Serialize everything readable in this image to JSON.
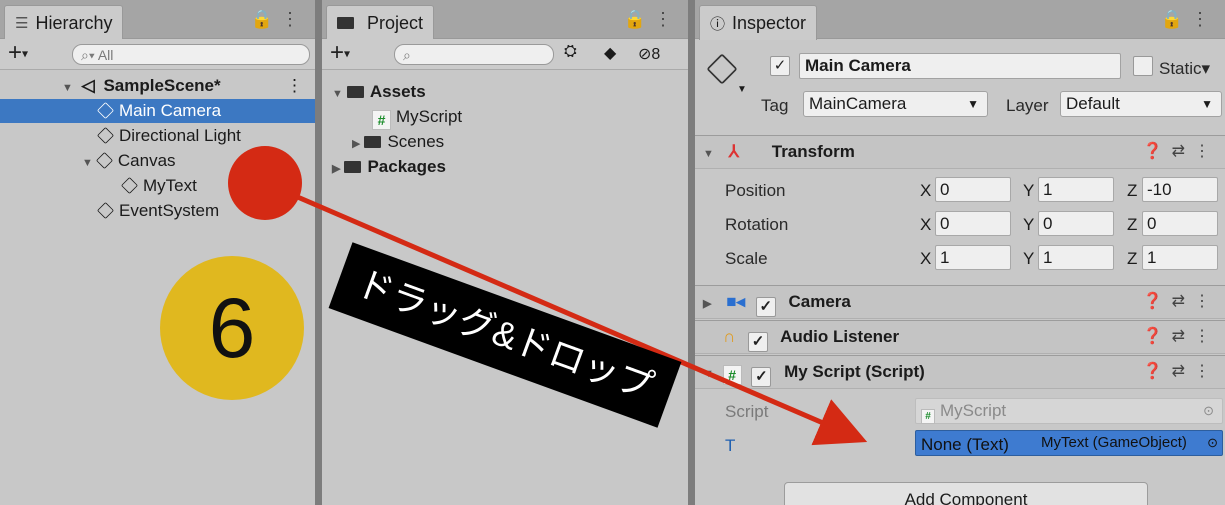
{
  "hierarchy": {
    "tab_label": "Hierarchy",
    "search_placeholder": "All",
    "scene": "SampleScene*",
    "items": [
      "Main Camera",
      "Directional Light",
      "Canvas",
      "MyText",
      "EventSystem"
    ]
  },
  "project": {
    "tab_label": "Project",
    "hidden_count": "8",
    "assets": "Assets",
    "myscript": "MyScript",
    "scenes": "Scenes",
    "packages": "Packages"
  },
  "inspector": {
    "tab_label": "Inspector",
    "object_name": "Main Camera",
    "static_label": "Static",
    "tag_label": "Tag",
    "tag_value": "MainCamera",
    "layer_label": "Layer",
    "layer_value": "Default",
    "transform": {
      "title": "Transform",
      "position_label": "Position",
      "pos_x": "0",
      "pos_y": "1",
      "pos_z": "-10",
      "rotation_label": "Rotation",
      "rot_x": "0",
      "rot_y": "0",
      "rot_z": "0",
      "scale_label": "Scale",
      "scl_x": "1",
      "scl_y": "1",
      "scl_z": "1",
      "x": "X",
      "y": "Y",
      "z": "Z"
    },
    "camera_title": "Camera",
    "audio_title": "Audio Listener",
    "script_title": "My Script (Script)",
    "script_label": "Script",
    "script_value": "MyScript",
    "t_label": "T",
    "t_value": "None (Text)",
    "drag_tooltip": "MyText (GameObject)",
    "add_component": "Add Component"
  },
  "annotation": {
    "step_number": "6",
    "caption": "ドラッグ&ドロップ"
  },
  "colors": {
    "selection": "#3c78c2",
    "badge": "#e0b81f",
    "arrow": "#d42a14"
  }
}
